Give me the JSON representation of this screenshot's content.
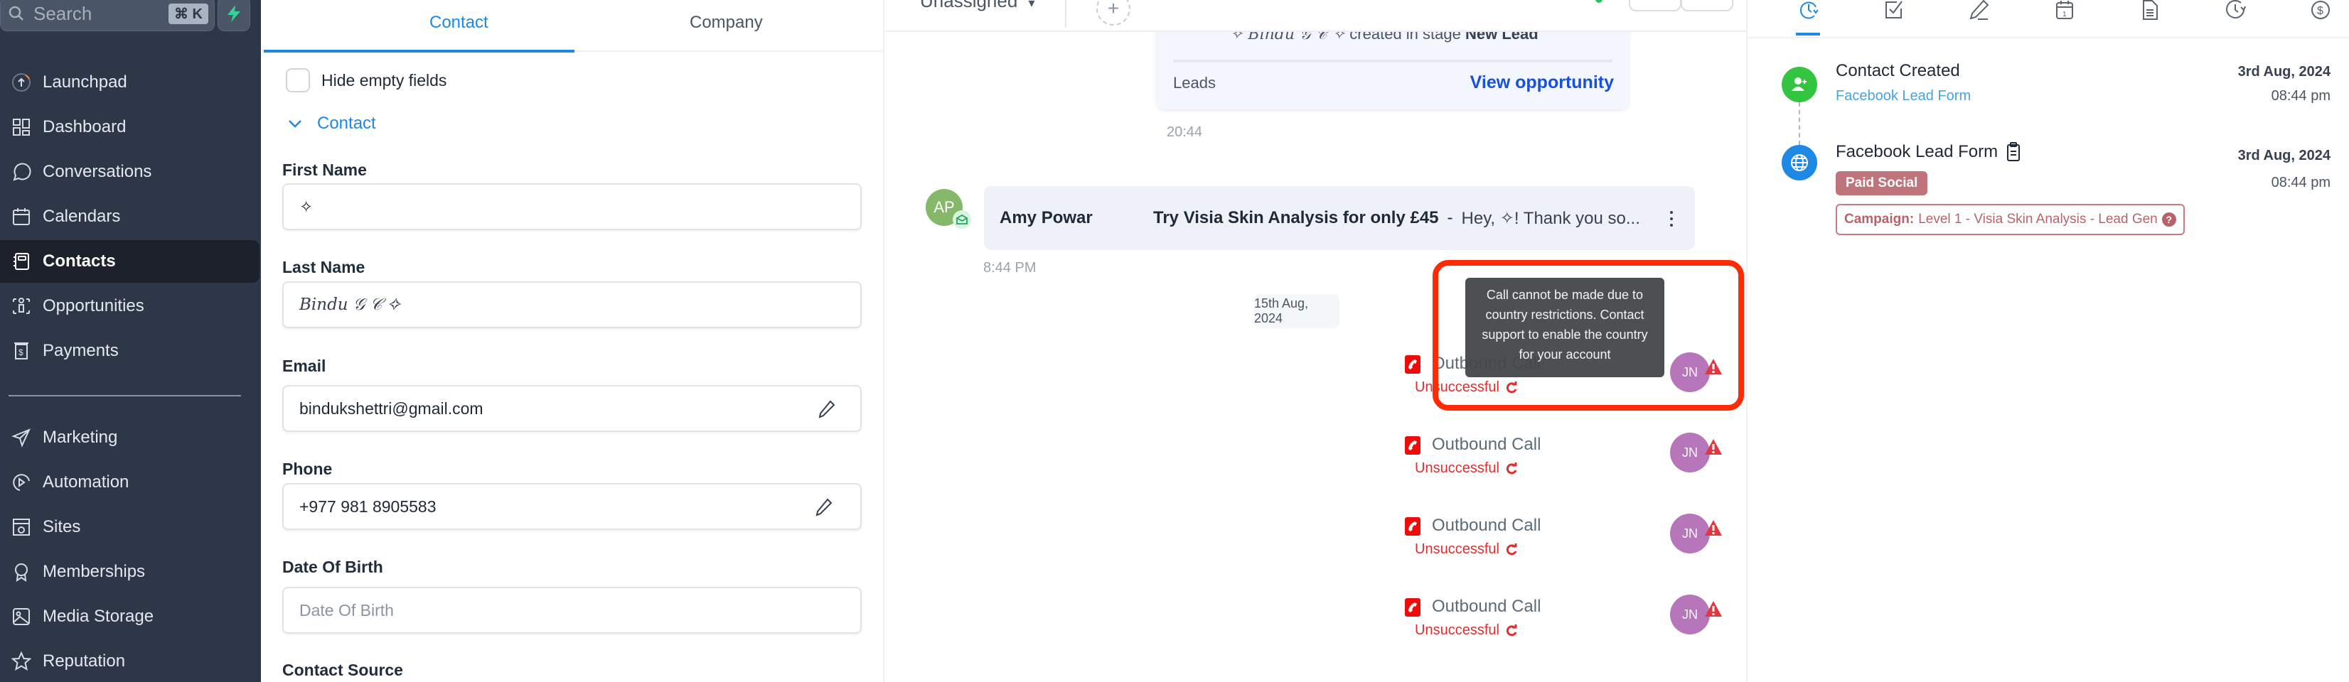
{
  "sidebar": {
    "search_placeholder": "Search",
    "search_shortcut": "⌘ K",
    "quick_action_icon": "bolt-icon",
    "items": [
      {
        "label": "Launchpad",
        "icon": "launchpad-icon",
        "active": false
      },
      {
        "label": "Dashboard",
        "icon": "dashboard-icon",
        "active": false
      },
      {
        "label": "Conversations",
        "icon": "chat-icon",
        "active": false
      },
      {
        "label": "Calendars",
        "icon": "calendar-icon",
        "active": false
      },
      {
        "label": "Contacts",
        "icon": "contacts-icon",
        "active": true
      },
      {
        "label": "Opportunities",
        "icon": "opportunities-icon",
        "active": false
      },
      {
        "label": "Payments",
        "icon": "payments-icon",
        "active": false
      },
      {
        "label": "Marketing",
        "icon": "send-icon",
        "active": false
      },
      {
        "label": "Automation",
        "icon": "automation-icon",
        "active": false
      },
      {
        "label": "Sites",
        "icon": "sites-icon",
        "active": false
      },
      {
        "label": "Memberships",
        "icon": "award-icon",
        "active": false
      },
      {
        "label": "Media Storage",
        "icon": "image-icon",
        "active": false
      },
      {
        "label": "Reputation",
        "icon": "star-icon",
        "active": false
      }
    ]
  },
  "details": {
    "tabs": [
      {
        "label": "Contact",
        "active": true
      },
      {
        "label": "Company",
        "active": false
      }
    ],
    "hide_empty_label": "Hide empty fields",
    "hide_empty_checked": false,
    "section_title": "Contact",
    "fields": {
      "first_name": {
        "label": "First Name",
        "value": "✧"
      },
      "last_name": {
        "label": "Last Name",
        "value": "𝐵𝑖𝑛𝑑𝑢 𝒢 𝒞 ✧"
      },
      "email": {
        "label": "Email",
        "value": "bindukshettri@gmail.com"
      },
      "phone": {
        "label": "Phone",
        "value": "+977 981 8905583"
      },
      "dob": {
        "label": "Date Of Birth",
        "value": "",
        "placeholder": "Date Of Birth"
      },
      "contact_source": {
        "label": "Contact Source"
      }
    }
  },
  "conversation": {
    "assignee": "Unassigned",
    "opportunity_card": {
      "contact_name": "✧ 𝐵𝑖𝑛𝑑𝑢 𝒢 𝒞 ✧",
      "created_text": "created in stage",
      "stage": "New Lead",
      "pipeline": "Leads",
      "link_label": "View opportunity",
      "time": "20:44"
    },
    "email_message": {
      "avatar_initials": "AP",
      "from": "Amy Powar",
      "subject": "Try Visia Skin Analysis for only £45",
      "separator": "-",
      "preview": "Hey, ✧! Thank you so...",
      "time": "8:44 PM"
    },
    "date_divider": "15th Aug, 2024",
    "tooltip": "Call cannot be made due to country restrictions. Contact support to enable the country for your account",
    "calls": [
      {
        "title": "Outbound Call",
        "status": "Unsuccessful",
        "agent_initials": "JN"
      },
      {
        "title": "Outbound Call",
        "status": "Unsuccessful",
        "agent_initials": "JN"
      },
      {
        "title": "Outbound Call",
        "status": "Unsuccessful",
        "agent_initials": "JN"
      },
      {
        "title": "Outbound Call",
        "status": "Unsuccessful",
        "agent_initials": "JN"
      }
    ]
  },
  "activity": {
    "tabs": [
      {
        "icon": "activity-icon",
        "active": true
      },
      {
        "icon": "task-icon",
        "active": false
      },
      {
        "icon": "notes-icon",
        "active": false
      },
      {
        "icon": "appointment-icon",
        "active": false
      },
      {
        "icon": "document-icon",
        "active": false
      },
      {
        "icon": "history-icon",
        "active": false
      },
      {
        "icon": "payment-icon",
        "active": false
      }
    ],
    "events": [
      {
        "title": "Contact Created",
        "subtitle": "Facebook Lead Form",
        "date": "3rd Aug, 2024",
        "time": "08:44 pm"
      },
      {
        "title": "Facebook Lead Form",
        "tag": "Paid Social",
        "campaign_label": "Campaign:",
        "campaign_value": "Level 1 - Visia Skin Analysis - Lead Gen",
        "date": "3rd Aug, 2024",
        "time": "08:44 pm"
      }
    ]
  },
  "colors": {
    "sidebar_bg": "#2d3748",
    "accent_blue": "#1e88e5",
    "link_blue": "#1650e0",
    "error_red": "#e02d2d",
    "highlight_red": "#ff2a06",
    "agent_avatar": "#b676b9",
    "tag_paid_social": "#bf737a"
  }
}
